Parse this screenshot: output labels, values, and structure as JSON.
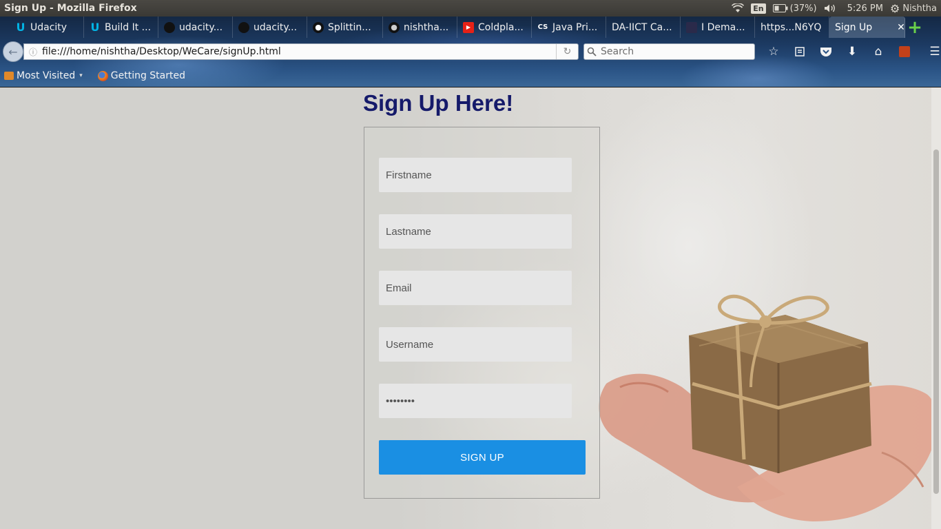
{
  "os_panel": {
    "window_title": "Sign Up - Mozilla Firefox",
    "keyboard": "En",
    "battery": "(37%)",
    "time": "5:26 PM",
    "user": "Nishtha"
  },
  "tabs": [
    {
      "label": "Udacity",
      "icon": "udacity-icon"
    },
    {
      "label": "Build It ...",
      "icon": "udacity-icon"
    },
    {
      "label": "udacity...",
      "icon": "github-icon"
    },
    {
      "label": "udacity...",
      "icon": "github-icon"
    },
    {
      "label": "Splittin...",
      "icon": "github-icon"
    },
    {
      "label": "nishtha...",
      "icon": "github-icon"
    },
    {
      "label": "Coldpla...",
      "icon": "youtube-icon"
    },
    {
      "label": "Java Pri...",
      "icon": "cs-icon"
    },
    {
      "label": "DA-IICT Ca...",
      "icon": "blank-icon"
    },
    {
      "label": "I Dema...",
      "icon": "site-icon"
    },
    {
      "label": "https...N6YQ",
      "icon": "blank-icon"
    },
    {
      "label": "Sign Up",
      "icon": "blank-icon",
      "active": true
    }
  ],
  "navbar": {
    "url": "file:///home/nishtha/Desktop/WeCare/signUp.html",
    "search_placeholder": "Search"
  },
  "bookmarks": [
    {
      "label": "Most Visited",
      "icon": "folder-icon"
    },
    {
      "label": "Getting Started",
      "icon": "firefox-icon"
    }
  ],
  "signup": {
    "heading": "Sign Up Here!",
    "firstname_placeholder": "Firstname",
    "lastname_placeholder": "Lastname",
    "email_placeholder": "Email",
    "username_placeholder": "Username",
    "password_value": "password",
    "submit_label": "SIGN UP"
  },
  "colors": {
    "heading": "#151a6a",
    "submit_button": "#1a8fe3",
    "field_background": "#e6e6e6"
  }
}
